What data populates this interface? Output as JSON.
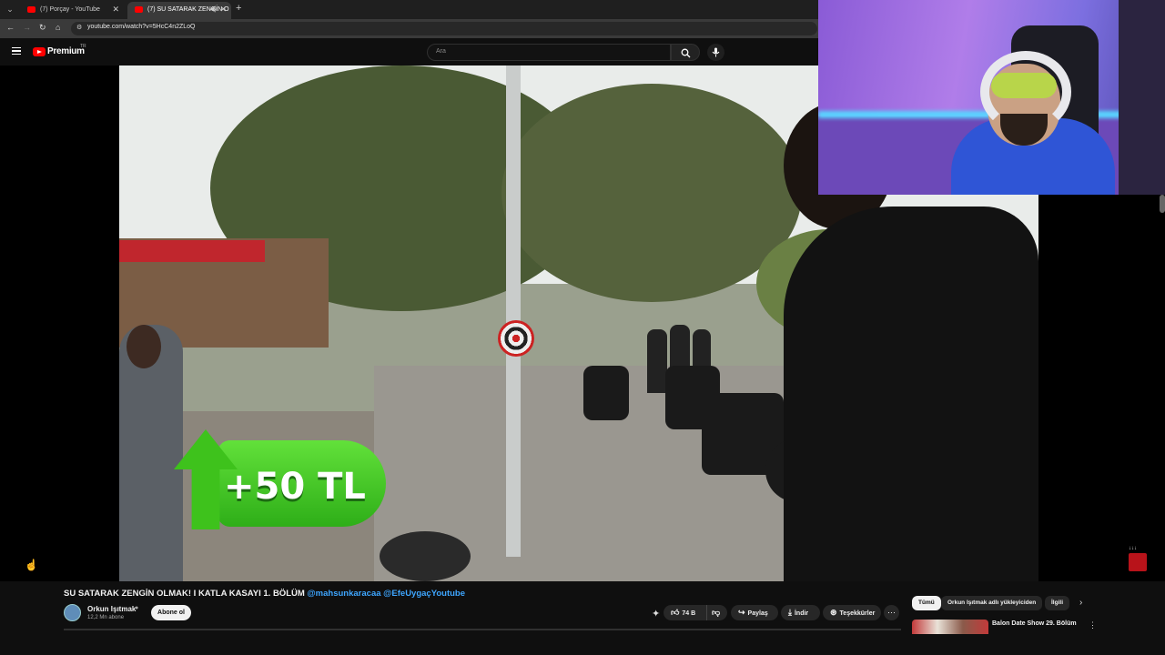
{
  "browser": {
    "tabs": [
      {
        "title": "(7) Porçay - YouTube",
        "active": false
      },
      {
        "title": "(7) SU SATARAK ZENGİN O",
        "active": true
      }
    ],
    "url": "youtube.com/watch?v=5HcC4n2ZLoQ"
  },
  "youtube": {
    "logo_text": "Premium",
    "logo_country": "TR",
    "search_placeholder": "Ara"
  },
  "video": {
    "overlay_amount": "+50 TL",
    "corner_logo_text": "↓↓↓"
  },
  "meta": {
    "title": "SU SATARAK ZENGİN OLMAK! I KATLA KASAYI 1. BÖLÜM",
    "tags": "@mahsunkaracaa @EfeUygaçYoutube",
    "channel": "Orkun Işıtmak",
    "subscribers": "12,2 Mn abone",
    "subscribe": "Abone ol",
    "likes": "74 B",
    "share": "Paylaş",
    "download": "İndir",
    "thanks": "Teşekkürler"
  },
  "sidebar": {
    "chips": [
      "Tümü",
      "Orkun Işıtmak adlı yükleyiciden",
      "İlgili"
    ],
    "rec_title": "Balon Date Show 29. Bölüm"
  },
  "colors": {
    "brand": "#ff0000",
    "link": "#3ea6ff",
    "badge_green": "#3ec21c"
  }
}
